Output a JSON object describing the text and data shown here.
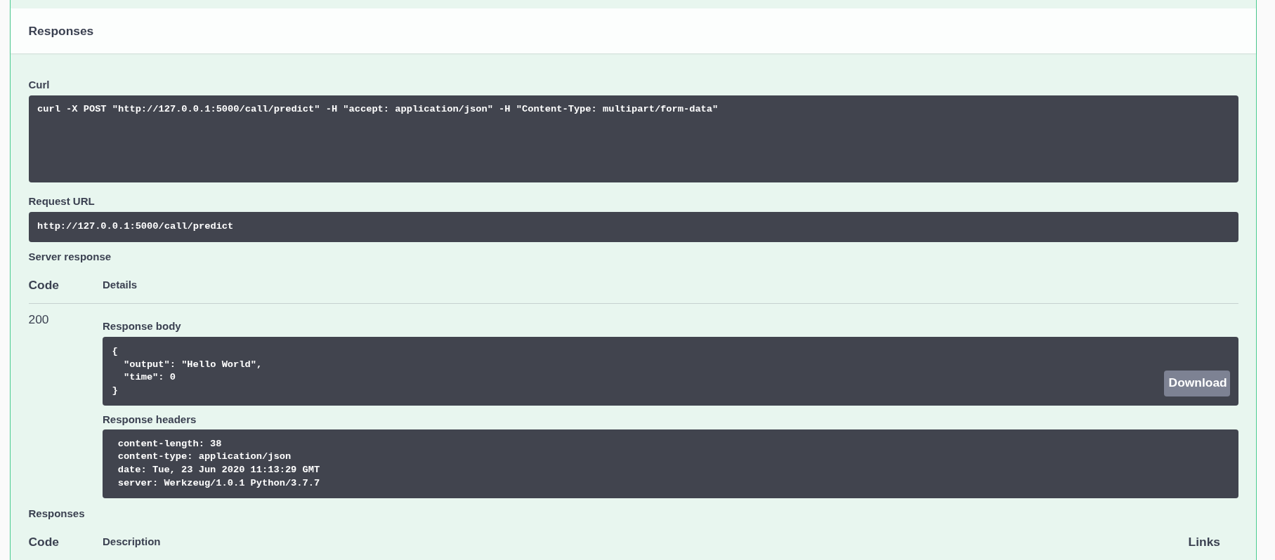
{
  "header": {
    "title": "Responses"
  },
  "curl": {
    "label": "Curl",
    "command": "curl -X POST \"http://127.0.0.1:5000/call/predict\" -H \"accept: application/json\" -H \"Content-Type: multipart/form-data\""
  },
  "request_url": {
    "label": "Request URL",
    "value": "http://127.0.0.1:5000/call/predict"
  },
  "server_response": {
    "label": "Server response",
    "columns": [
      "Code",
      "Details"
    ],
    "rows": [
      {
        "code": "200",
        "body_label": "Response body",
        "body": "{\n  \"output\": \"Hello World\",\n  \"time\": 0\n}",
        "download_button": "Download",
        "headers_label": "Response headers",
        "headers": [
          "content-length: 38",
          "content-type: application/json",
          "date: Tue, 23 Jun 2020 11:13:29 GMT",
          "server: Werkzeug/1.0.1 Python/3.7.7"
        ]
      }
    ]
  },
  "responses": {
    "label": "Responses",
    "columns": [
      "Code",
      "Description",
      "Links"
    ]
  }
}
